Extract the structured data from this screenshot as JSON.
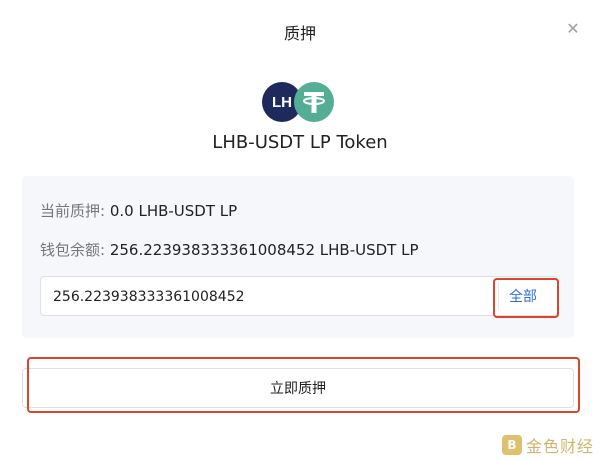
{
  "dialog": {
    "title": "质押",
    "close_icon": "close-icon",
    "token_name": "LHB-USDT LP Token",
    "logos": {
      "left": "LHB",
      "right": "USDT"
    }
  },
  "info": {
    "staked_label": "当前质押:",
    "staked_value": "0.0 LHB-USDT LP",
    "balance_label": "钱包余额:",
    "balance_value": "256.223938333361008452 LHB-USDT LP"
  },
  "amount_input": {
    "value": "256.223938333361008452",
    "placeholder": ""
  },
  "all_button_label": "全部",
  "stake_button_label": "立即质押",
  "watermark": {
    "text": "金色财经"
  },
  "colors": {
    "highlight": "#d9452b",
    "link": "#2d6fd9",
    "usdt": "#53ae94",
    "lhb": "#1f2a5c"
  }
}
